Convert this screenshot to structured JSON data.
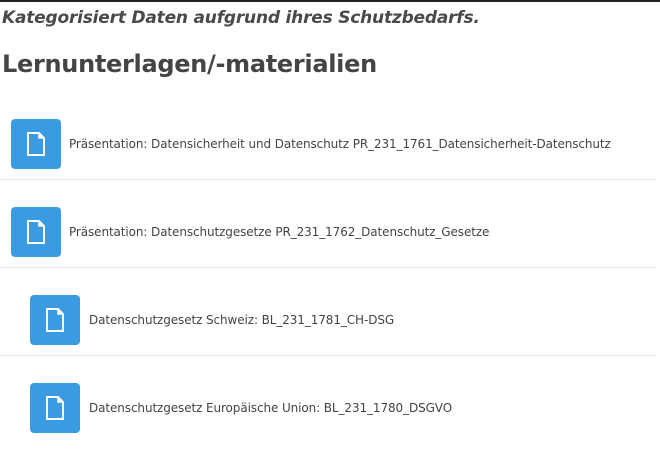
{
  "subtitle": "Kategorisiert Daten aufgrund ihres Schutzbedarfs.",
  "heading": "Lernunterlagen/-materialien",
  "items": [
    {
      "label": "Präsentation: Datensicherheit und Datenschutz PR_231_1761_Datensicherheit-Datenschutz",
      "icon": "file-icon"
    },
    {
      "label": "Präsentation: Datenschutzgesetze PR_231_1762_Datenschutz_Gesetze",
      "icon": "file-icon"
    },
    {
      "label": "Datenschutzgesetz Schweiz: BL_231_1781_CH-DSG",
      "icon": "file-icon"
    },
    {
      "label": "Datenschutzgesetz Europäische Union: BL_231_1780_DSGVO",
      "icon": "file-icon"
    }
  ],
  "colors": {
    "accent": "#3a9be0",
    "text": "#444444",
    "divider": "#e6e6e6"
  }
}
